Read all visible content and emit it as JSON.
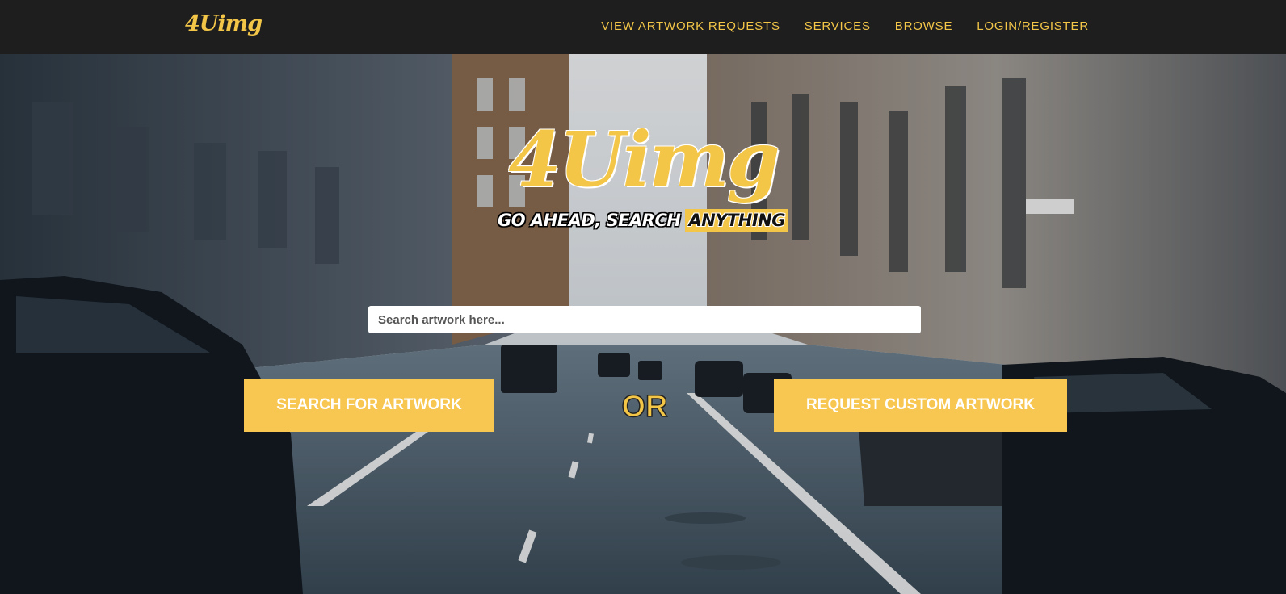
{
  "navbar": {
    "brand": "4Uimg",
    "links": [
      "VIEW ARTWORK REQUESTS",
      "SERVICES",
      "BROWSE",
      "LOGIN/REGISTER"
    ]
  },
  "hero": {
    "title": "4Uimg",
    "tagline_main": "GO AHEAD, SEARCH",
    "tagline_highlight": "ANYTHING",
    "search_placeholder": "Search artwork here...",
    "search_button": "SEARCH FOR ARTWORK",
    "or_text": "OR",
    "request_button": "REQUEST CUSTOM ARTWORK",
    "background_image": "city-street-photo"
  },
  "colors": {
    "navbar_bg": "#1e1e1e",
    "accent": "#f3c648",
    "button_bg": "#f7c752"
  }
}
